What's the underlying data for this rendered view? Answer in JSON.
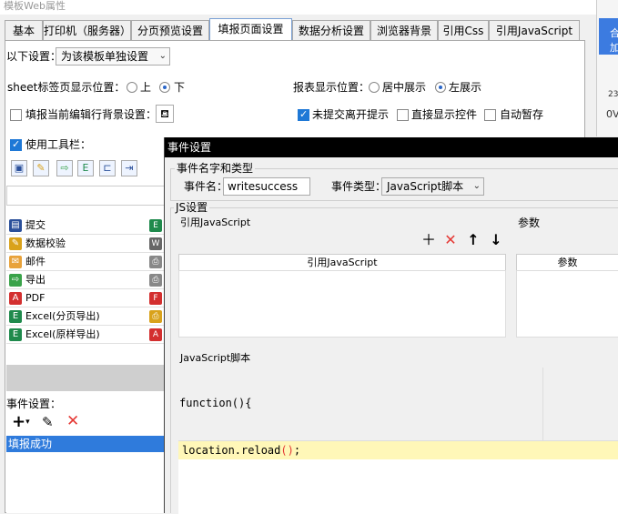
{
  "window": {
    "title": "模板Web属性"
  },
  "right_strip": {
    "text": "合 加",
    "linenum": "23",
    "ov": "0V"
  },
  "tabs": [
    {
      "label": "基本",
      "active": false
    },
    {
      "label": "打印机（服务器）",
      "active": false
    },
    {
      "label": "分页预览设置",
      "active": false
    },
    {
      "label": "填报页面设置",
      "active": true
    },
    {
      "label": "数据分析设置",
      "active": false
    },
    {
      "label": "浏览器背景",
      "active": false
    },
    {
      "label": "引用Css",
      "active": false
    },
    {
      "label": "引用JavaScript",
      "active": false
    }
  ],
  "settings": {
    "apply_label": "以下设置：",
    "apply_value": "为该模板单独设置",
    "sheet_pos_label": "sheet标签页显示位置：",
    "sheet_top": "上",
    "sheet_bottom": "下",
    "report_pos_label": "报表显示位置：",
    "report_center": "居中展示",
    "report_left": "左展示",
    "bg_label": "填报当前编辑行背景设置：",
    "no_submit_label": "未提交离开提示",
    "direct_show_label": "直接显示控件",
    "auto_save_label": "自动暂存",
    "toolbar_label": "使用工具栏："
  },
  "button_list": [
    {
      "label": "提交",
      "icon": "submit-icon",
      "color": "#2a4f9a"
    },
    {
      "label": "数据校验",
      "icon": "pencil-icon",
      "color": "#d9a21b"
    },
    {
      "label": "邮件",
      "icon": "mail-icon",
      "color": "#e8a23a"
    },
    {
      "label": "导出",
      "icon": "export-icon",
      "color": "#3aa34a"
    },
    {
      "label": "PDF",
      "icon": "pdf-icon",
      "color": "#d32f2f"
    },
    {
      "label": "Excel(分页导出)",
      "icon": "excel-icon",
      "color": "#1f8a4c"
    },
    {
      "label": "Excel(原样导出)",
      "icon": "excel-icon",
      "color": "#1f8a4c"
    }
  ],
  "events": {
    "label": "事件设置：",
    "items": [
      "填报成功"
    ]
  },
  "dialog": {
    "title": "事件设置",
    "group_name_type": "事件名字和类型",
    "event_name_label": "事件名：",
    "event_name_value": "writesuccess",
    "event_type_label": "事件类型：",
    "event_type_value": "JavaScript脚本",
    "js_group": "JS设置",
    "ref_js_label": "引用JavaScript",
    "params_label": "参数",
    "col_ref_js": "引用JavaScript",
    "col_params": "参数",
    "js_script_label": "JavaScript脚本",
    "func_signature": "function(){",
    "code_pre": "location.reload",
    "code_paren_open": "(",
    "code_paren_close": ")",
    "code_semi": ";"
  },
  "colors": {
    "accent": "#2f7bdc",
    "highlight": "#fff7b8",
    "delete": "#e53935"
  }
}
